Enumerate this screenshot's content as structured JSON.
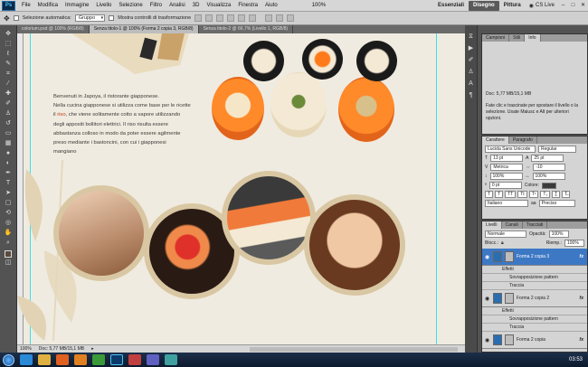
{
  "menubar": {
    "logo": "Ps",
    "items": [
      "File",
      "Modifica",
      "Immagine",
      "Livello",
      "Selezione",
      "Filtro",
      "Analisi",
      "3D",
      "Visualizza",
      "Finestra",
      "Aiuto"
    ],
    "zoom": "100%",
    "workspaces": [
      "Essenziali",
      "Disegno",
      "Pittura"
    ],
    "cslive": "CS Live"
  },
  "options": {
    "auto_select_label": "Selezione automatica:",
    "auto_select_value": "Gruppo",
    "transform_label": "Mostra controlli di trasformazione"
  },
  "tabs": [
    {
      "label": "colorium.psd @ 100% (RGB/8)"
    },
    {
      "label": "Senza titolo-1 @ 100% (Forma 2 copia 3, RGB/8)"
    },
    {
      "label": "Senza titolo-2 @ 66,7% (Livello 1, RGB/8)"
    }
  ],
  "document": {
    "line1": "Benvenuti in Japoya, il ristorante giapponese.",
    "line2": "Nella cucina giapponese si utilizza come base per le ricette",
    "line3a": "il",
    "line3b": "riso",
    "line3c": ", che viene solitamente cotto a vapore utilizzando",
    "line4": "degli appositi bollitori elettrici. Il riso risulta essere",
    "line5": "abbastanza colloso in modo da poter essere agilmente",
    "line6": "preso mediante i bastoncini, con cui i giapponesi",
    "line7": "mangiano"
  },
  "status": {
    "zoom": "100%",
    "doc": "Doc: 5,77 MB/15,1 MB"
  },
  "info_panel": {
    "tabs": [
      "Campioni",
      "Stili",
      "Info"
    ],
    "doc": "Doc: 5,77 MB/15,1 MB",
    "hint": "Fate clic e trascinate per spostare il livello o la selezione. Usate Maiusc e Alt per ulteriori opzioni."
  },
  "char_panel": {
    "tabs": [
      "Carattere",
      "Paragrafo"
    ],
    "font": "Lucida Sans Unicode",
    "style": "Regular",
    "size": "13 pt",
    "leading": "25 pt",
    "kerning": "Metrica",
    "tracking": "-10",
    "vscale": "100%",
    "hscale": "100%",
    "baseline": "0 pt",
    "color_label": "Colore:",
    "language": "Italiano",
    "aa": "Preciso"
  },
  "layers_panel": {
    "tabs": [
      "Livelli",
      "Canali",
      "Tracciati"
    ],
    "blend": "Normale",
    "opacity_label": "Opacità:",
    "opacity": "100%",
    "lock_label": "Blocc.:",
    "fill_label": "Riemp.:",
    "fill": "100%",
    "layers": [
      {
        "name": "Forma 2 copia 3",
        "selected": true
      },
      {
        "name": "Effetti"
      },
      {
        "name": "Sovrapposizione pattern"
      },
      {
        "name": "Traccia"
      },
      {
        "name": "Forma 2 copia 2",
        "selected": false
      },
      {
        "name": "Effetti"
      },
      {
        "name": "Sovrapposizione pattern"
      },
      {
        "name": "Traccia"
      },
      {
        "name": "Forma 2 copia",
        "selected": false
      }
    ]
  },
  "taskbar": {
    "time": "03:53"
  }
}
